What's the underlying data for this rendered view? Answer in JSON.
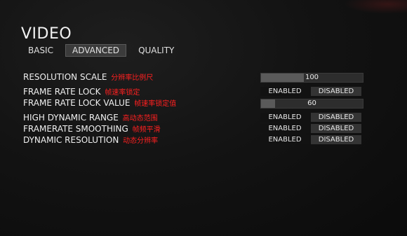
{
  "page": {
    "title": "VIDEO"
  },
  "tabs": [
    {
      "label": "BASIC",
      "active": false
    },
    {
      "label": "ADVANCED",
      "active": true
    },
    {
      "label": "QUALITY",
      "active": false
    }
  ],
  "settings": {
    "resolution_scale": {
      "label": "RESOLUTION SCALE",
      "note": "分辨率比例尺",
      "value": "100",
      "fill_fraction": 0.42
    },
    "frame_rate_lock": {
      "label": "FRAME RATE LOCK",
      "note": "帧速率锁定",
      "options": [
        "ENABLED",
        "DISABLED"
      ],
      "selected": "DISABLED"
    },
    "frame_rate_lock_value": {
      "label": "FRAME RATE LOCK VALUE",
      "note": "帧速率锁定值",
      "value": "60",
      "fill_fraction": 0.14
    },
    "high_dynamic_range": {
      "label": "HIGH DYNAMIC RANGE",
      "note": "高动态范围",
      "options": [
        "ENABLED",
        "DISABLED"
      ],
      "selected": "DISABLED"
    },
    "framerate_smoothing": {
      "label": "FRAMERATE SMOOTHING",
      "note": "帧频平滑",
      "options": [
        "ENABLED",
        "DISABLED"
      ],
      "selected": "DISABLED"
    },
    "dynamic_resolution": {
      "label": "DYNAMIC RESOLUTION",
      "note": "动态分辨率",
      "options": [
        "ENABLED",
        "DISABLED"
      ],
      "selected": "DISABLED"
    }
  },
  "colors": {
    "annotation": "#ff2020",
    "selected_option": "#343434",
    "slider_fill": "#5a5a5a"
  }
}
